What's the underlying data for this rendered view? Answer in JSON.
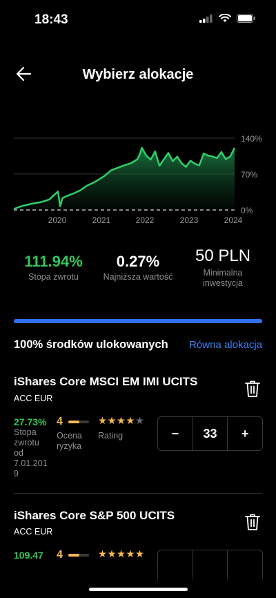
{
  "status_bar": {
    "time": "18:43"
  },
  "header": {
    "title": "Wybierz alokacje"
  },
  "chart_data": {
    "type": "area",
    "x_ticks": [
      "2020",
      "2021",
      "2022",
      "2023",
      "2024"
    ],
    "y_ticks": [
      "140%",
      "70%",
      "0%"
    ],
    "ylim": [
      0,
      140
    ],
    "series": [
      {
        "x": [
          2019.1,
          2019.3,
          2019.5,
          2019.7,
          2019.9,
          2020.1,
          2020.15,
          2020.2,
          2020.3,
          2020.45,
          2020.6,
          2020.75,
          2020.9,
          2021.0,
          2021.15,
          2021.3,
          2021.45,
          2021.6,
          2021.75,
          2021.9,
          2021.95,
          2022.0,
          2022.1,
          2022.2,
          2022.3,
          2022.4,
          2022.5,
          2022.6,
          2022.7,
          2022.8,
          2022.9,
          2023.0,
          2023.1,
          2023.2,
          2023.3,
          2023.4,
          2023.5,
          2023.6,
          2023.7,
          2023.8,
          2023.9,
          2024.0,
          2024.1
        ],
        "y": [
          2,
          8,
          12,
          15,
          20,
          36,
          7,
          23,
          27,
          32,
          38,
          47,
          53,
          58,
          66,
          77,
          82,
          87,
          91,
          99,
          108,
          121,
          106,
          98,
          114,
          86,
          99,
          111,
          95,
          104,
          91,
          84,
          96,
          90,
          87,
          110,
          106,
          104,
          101,
          113,
          99,
          104,
          121
        ]
      }
    ]
  },
  "stats": [
    {
      "value": "111.94%",
      "label": "Stopa zwrotu"
    },
    {
      "value": "0.27%",
      "label": "Najniższa wartość"
    },
    {
      "value": "50 PLN",
      "label_line1": "Minimalna",
      "label_line2": "inwestycja"
    }
  ],
  "allocation": {
    "progress_fraction": 1.0,
    "title": "100% środków ulokowanych",
    "equal_link": "Równa alokacja"
  },
  "funds": [
    {
      "name": "iShares Core MSCI EM IMI UCITS",
      "sub": "ACC EUR",
      "return_value": "27.73%",
      "return_label_lines": [
        "Stopa",
        "zwrotu",
        "od",
        "7.01.201",
        "9"
      ],
      "risk": "4",
      "risk_label_lines": [
        "Ocena",
        "ryzyka"
      ],
      "risk_fraction": 0.55,
      "rating_stars": 4,
      "rating_label": "Rating",
      "minus": "−",
      "quantity": "33",
      "plus": "+"
    },
    {
      "name": "iShares Core S&P 500 UCITS",
      "sub": "ACC EUR",
      "return_value": "109.47",
      "risk": "4",
      "risk_fraction": 0.55,
      "rating_stars": 5
    }
  ]
}
